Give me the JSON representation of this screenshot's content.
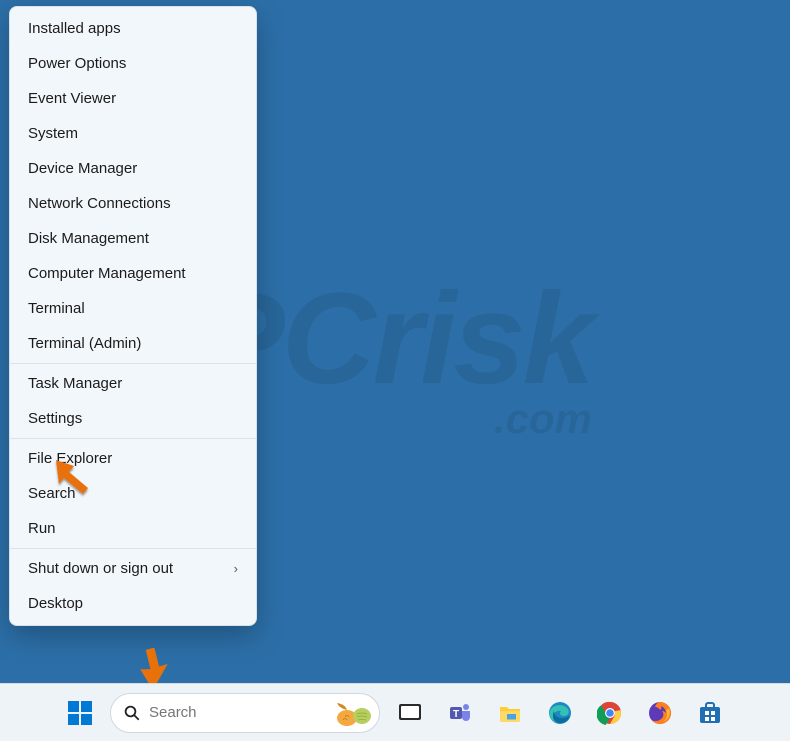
{
  "context_menu": {
    "groups": [
      [
        "Installed apps",
        "Power Options",
        "Event Viewer",
        "System",
        "Device Manager",
        "Network Connections",
        "Disk Management",
        "Computer Management",
        "Terminal",
        "Terminal (Admin)"
      ],
      [
        "Task Manager",
        "Settings"
      ],
      [
        "File Explorer",
        "Search",
        "Run"
      ],
      [
        "Shut down or sign out",
        "Desktop"
      ]
    ],
    "submenu_items": [
      "Shut down or sign out"
    ]
  },
  "taskbar": {
    "search_placeholder": "Search",
    "icons": [
      "task-view",
      "teams",
      "file-explorer",
      "edge",
      "chrome",
      "firefox",
      "microsoft-store"
    ]
  },
  "annotation": {
    "arrow_at": "Settings",
    "arrow_at_start": true
  }
}
